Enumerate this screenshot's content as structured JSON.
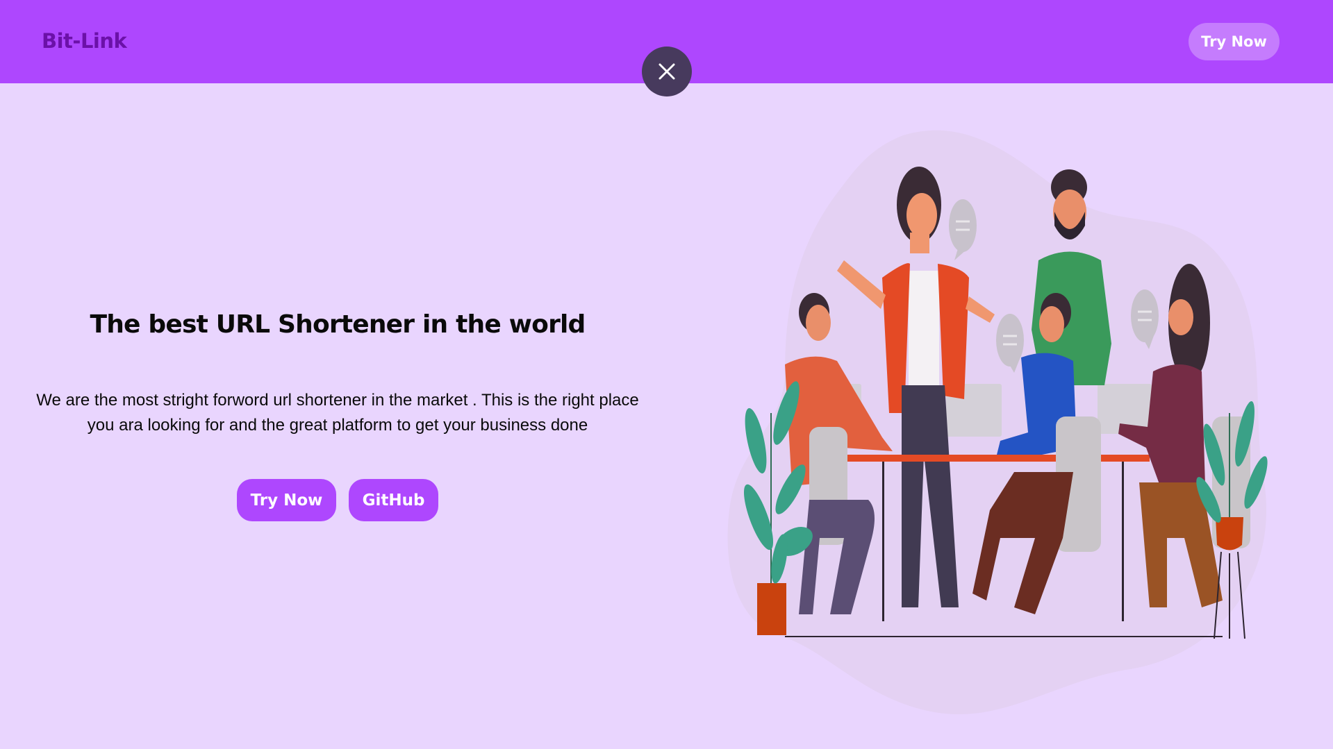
{
  "navbar": {
    "brand": "Bit-Link",
    "try_label": "Try Now",
    "bg_color": "#ae47fe"
  },
  "close_button": {
    "icon": "close-icon"
  },
  "hero": {
    "title": "The best URL Shortener in the world",
    "description_line1": "We are the most stright forword url shortener in the market . This is the right place",
    "description_line2": "you ara looking for and the great platform to get your business done",
    "try_label": "Try Now",
    "github_label": "GitHub"
  },
  "illustration": {
    "subject": "team-meeting-illustration"
  },
  "colors": {
    "page_bg": "#e9d5fe",
    "accent": "#ae47fe",
    "close_bg": "#473a5d"
  }
}
